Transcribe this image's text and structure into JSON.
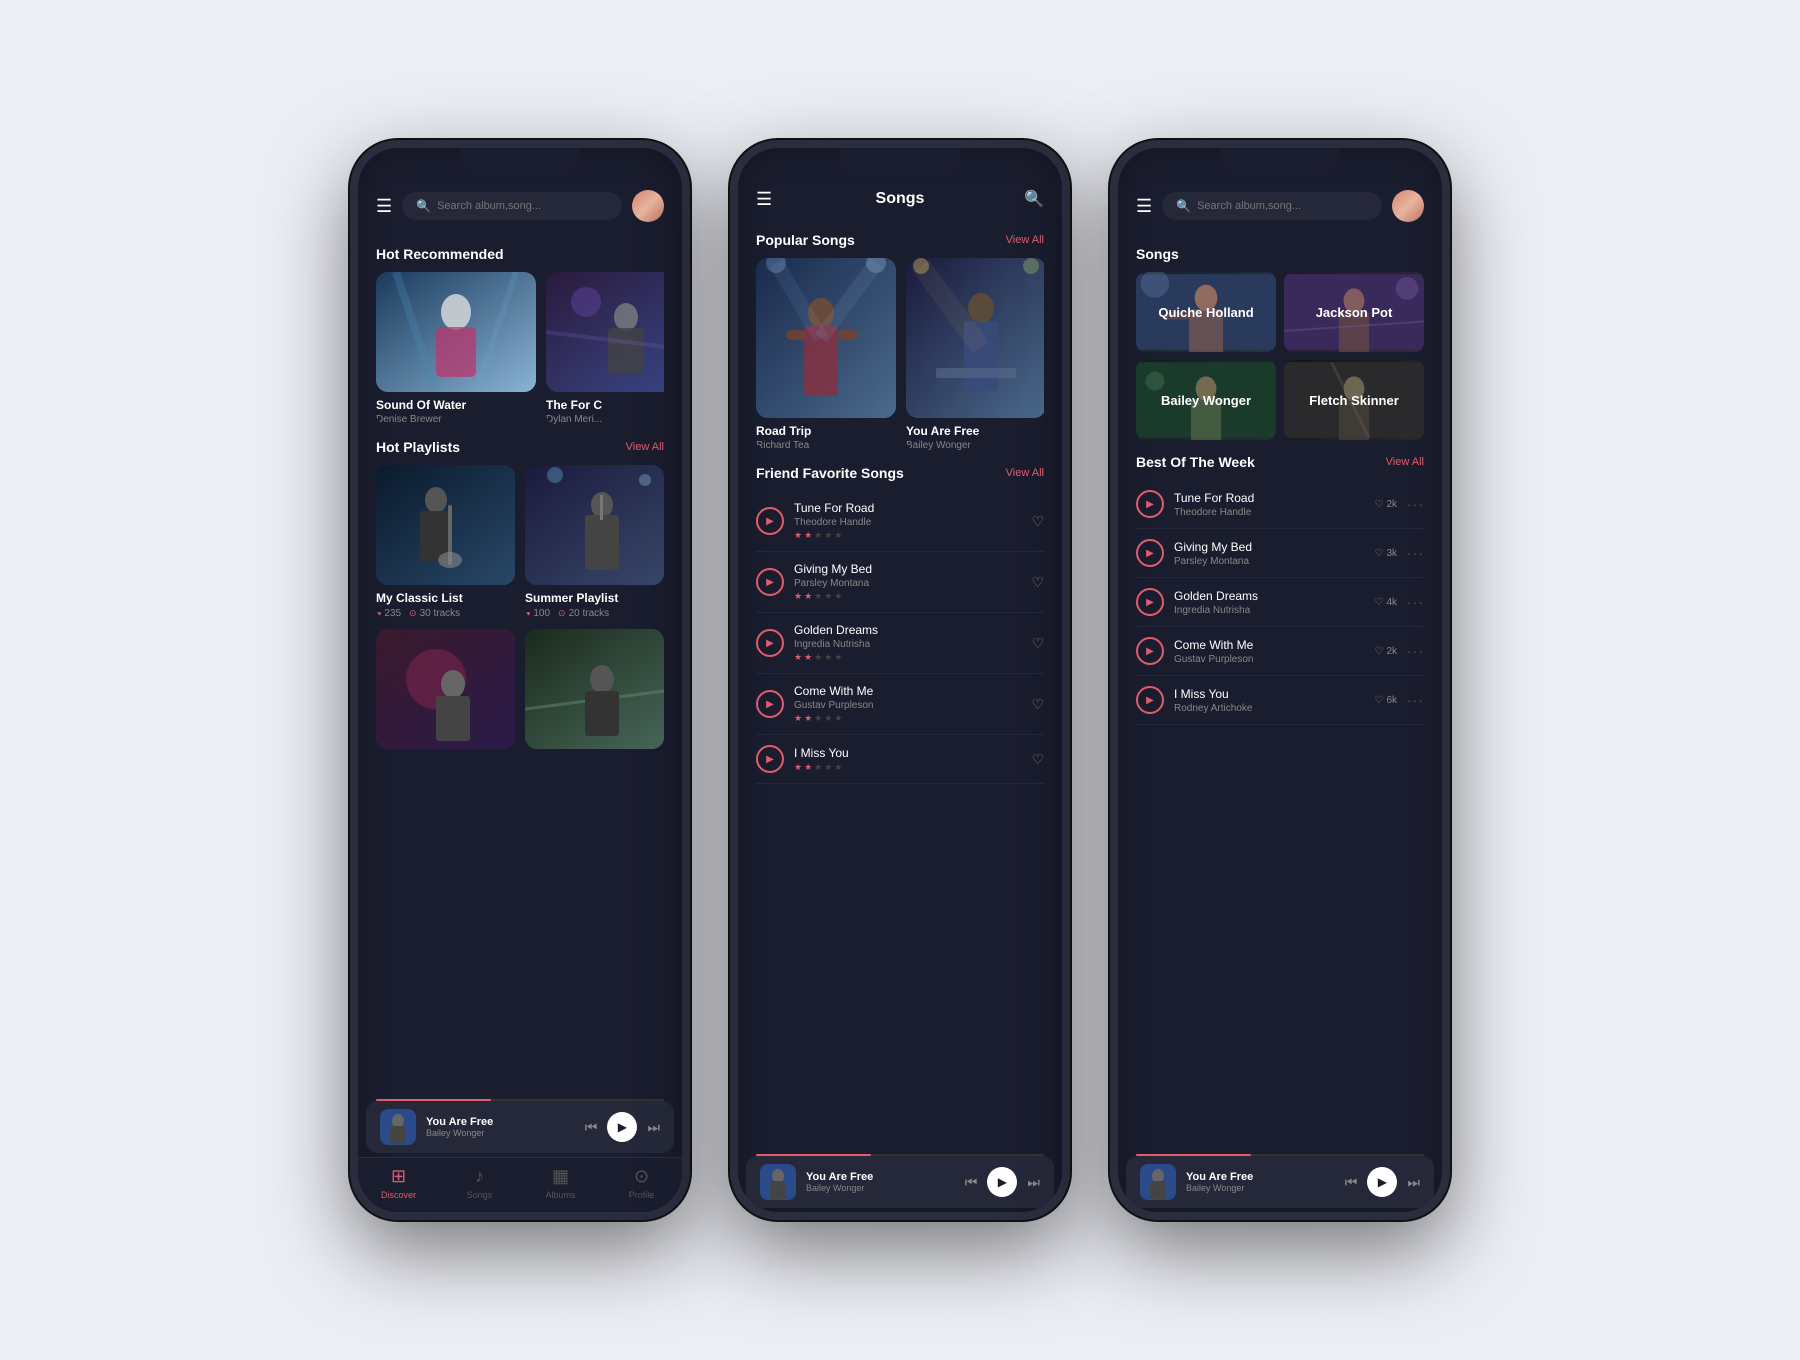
{
  "phones": [
    {
      "id": "phone1",
      "header": {
        "type": "search",
        "search_placeholder": "Search album,song...",
        "has_avatar": true
      },
      "sections": [
        {
          "type": "hot_recommended",
          "title": "Hot Recommended",
          "cards": [
            {
              "title": "Sound Of Water",
              "artist": "Denise Brewer",
              "gradient": 1
            },
            {
              "title": "The For C",
              "artist": "Dylan Meri...",
              "gradient": 2
            }
          ]
        },
        {
          "type": "hot_playlists",
          "title": "Hot Playlists",
          "view_all": "View All",
          "cards": [
            {
              "title": "My Classic List",
              "likes": "235",
              "tracks": "30 tracks",
              "gradient": 3
            },
            {
              "title": "Summer Playlist",
              "likes": "100",
              "tracks": "20 tracks",
              "gradient": 4
            },
            {
              "title": "",
              "likes": "",
              "tracks": "",
              "gradient": 5
            },
            {
              "title": "",
              "likes": "",
              "tracks": "",
              "gradient": 6
            }
          ]
        }
      ],
      "nav": [
        {
          "icon": "⊞",
          "label": "Discover",
          "active": true
        },
        {
          "icon": "♪",
          "label": "Songs",
          "active": false
        },
        {
          "icon": "▦",
          "label": "Albums",
          "active": false
        },
        {
          "icon": "⊙",
          "label": "Profile",
          "active": false
        }
      ],
      "now_playing": {
        "title": "You Are Free",
        "artist": "Bailey Wonger",
        "gradient": 7
      }
    },
    {
      "id": "phone2",
      "header": {
        "type": "centered",
        "title": "Songs",
        "has_search": true
      },
      "sections": [
        {
          "type": "popular_songs",
          "title": "Popular Songs",
          "view_all": "View All",
          "cards": [
            {
              "title": "Road Trip",
              "artist": "Richard Tea",
              "gradient": 1
            },
            {
              "title": "You Are Free",
              "artist": "Bailey Wonger",
              "gradient": 8
            }
          ]
        },
        {
          "type": "friend_favorites",
          "title": "Friend Favorite Songs",
          "view_all": "View All",
          "songs": [
            {
              "title": "Tune For Road",
              "artist": "Theodore Handle",
              "liked": false,
              "stars": 2
            },
            {
              "title": "Giving My Bed",
              "artist": "Parsley Montana",
              "liked": false,
              "stars": 2
            },
            {
              "title": "Golden Dreams",
              "artist": "Ingredia Nutrisha",
              "liked": false,
              "stars": 2
            },
            {
              "title": "Come With Me",
              "artist": "Gustav Purpleson",
              "liked": false,
              "stars": 2
            },
            {
              "title": "I Miss You",
              "artist": "",
              "liked": false,
              "stars": 2
            }
          ]
        }
      ],
      "now_playing": {
        "title": "You Are Free",
        "artist": "Bailey Wonger",
        "gradient": 7
      }
    },
    {
      "id": "phone3",
      "header": {
        "type": "search",
        "search_placeholder": "Search album,song...",
        "has_avatar": true
      },
      "sections": [
        {
          "type": "artists",
          "title": "Songs",
          "artists": [
            {
              "name": "Quiche Holland",
              "gradient": 3
            },
            {
              "name": "Jackson Pot",
              "gradient": 4
            },
            {
              "name": "Bailey Wonger",
              "gradient": 5
            },
            {
              "name": "Fletch Skinner",
              "gradient": 6
            }
          ]
        },
        {
          "type": "best_of_week",
          "title": "Best Of The Week",
          "view_all": "View All",
          "songs": [
            {
              "title": "Tune For Road",
              "artist": "Theodore Handle",
              "likes": "2k"
            },
            {
              "title": "Giving My Bed",
              "artist": "Parsley Montana",
              "likes": "3k"
            },
            {
              "title": "Golden Dreams",
              "artist": "Ingredia Nutrisha",
              "likes": "4k"
            },
            {
              "title": "Come With Me",
              "artist": "Gustav Purpleson",
              "likes": "2k"
            },
            {
              "title": "I Miss You",
              "artist": "Rodney Artichoke",
              "likes": "6k"
            }
          ]
        }
      ],
      "now_playing": {
        "title": "You Are Free",
        "artist": "Bailey Wonger",
        "gradient": 7
      }
    }
  ],
  "labels": {
    "view_all": "View All",
    "search_placeholder": "Search album,song...",
    "songs_title": "Songs",
    "discover": "Discover",
    "songs": "Songs",
    "albums": "Albums",
    "profile": "Profile",
    "hot_recommended": "Hot Recommended",
    "hot_playlists": "Hot Playlists",
    "popular_songs": "Popular Songs",
    "friend_favorites": "Friend Favorite Songs",
    "best_of_week": "Best Of The Week"
  }
}
